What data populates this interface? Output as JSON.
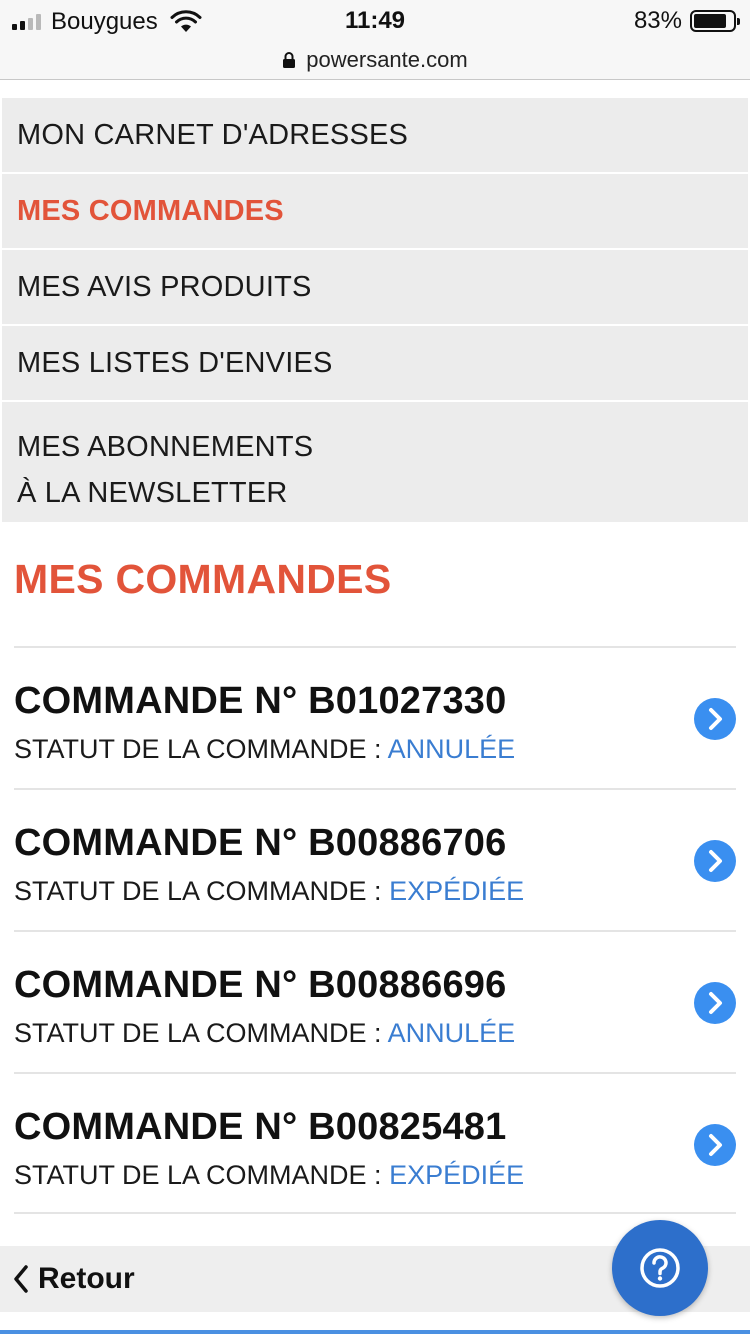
{
  "status_bar": {
    "carrier": "Bouygues",
    "time": "11:49",
    "battery_percent": "83%",
    "battery_level": 0.83,
    "signal_bars_active": 2,
    "icons": [
      "signal-icon",
      "wifi-icon",
      "battery-icon"
    ]
  },
  "browser": {
    "url": "powersante.com",
    "icon": "lock-icon"
  },
  "menu": {
    "items": [
      {
        "label": "MON CARNET D'ADRESSES"
      },
      {
        "label": "MES COMMANDES",
        "active": true
      },
      {
        "label": "MES AVIS PRODUITS"
      },
      {
        "label": "MES LISTES D'ENVIES"
      },
      {
        "label_line1": "MES ABONNEMENTS",
        "label_line2": "À LA NEWSLETTER"
      }
    ]
  },
  "orders": {
    "title": "MES COMMANDES",
    "status_label": "STATUT DE LA COMMANDE :",
    "items": [
      {
        "number": "COMMANDE N° B01027330",
        "status": "ANNULÉE"
      },
      {
        "number": "COMMANDE N° B00886706",
        "status": "EXPÉDIÉE"
      },
      {
        "number": "COMMANDE N° B00886696",
        "status": "ANNULÉE"
      },
      {
        "number": "COMMANDE N° B00825481",
        "status": "EXPÉDIÉE"
      }
    ]
  },
  "footer": {
    "back_label": "Retour",
    "help_icon": "question-mark-icon"
  },
  "colors": {
    "accent": "#e2543a",
    "status_link": "#3a7dd1",
    "chevron_button": "#3a8ff0",
    "help_button": "#2d6fcb",
    "menu_background": "#ececec"
  }
}
